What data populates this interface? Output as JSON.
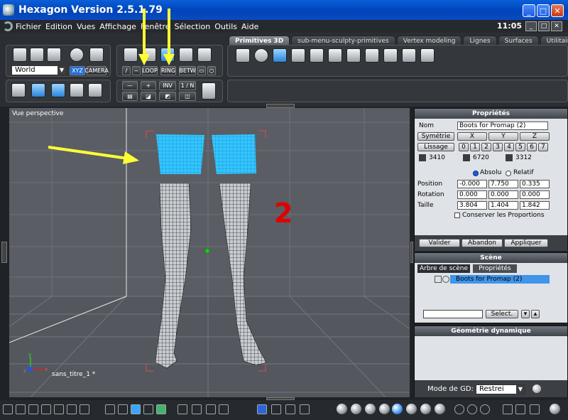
{
  "window": {
    "title": "Hexagon Version 2.5.1.79",
    "min": "_",
    "max": "□",
    "close": "✕"
  },
  "menu": {
    "items": [
      "Fichier",
      "Edition",
      "Vues",
      "Affichage",
      "Fenêtre",
      "Sélection",
      "Outils",
      "Aide"
    ],
    "time": "11:05",
    "doc_btns": [
      "_",
      "□",
      "✕"
    ]
  },
  "tabs": [
    "Primitives 3D",
    "sub-menu-sculpty-primitives",
    "Vertex modeling",
    "Lignes",
    "Surfaces",
    "Utilitaires"
  ],
  "toolbar": {
    "world_select": "World",
    "xyz_label": "XYZ",
    "camera_label": "CAMERA",
    "loop_label": "LOOP",
    "ring_label": "RING",
    "betw_label": "BETW",
    "minus_label": "—",
    "plus_label": "+",
    "inv_label": "INV",
    "one_n_label": "1 / N"
  },
  "viewport": {
    "label": "Vue perspective",
    "annotation_number": "2",
    "object_name": "sans_titre_1 *",
    "axis_labels": [
      "y",
      "z",
      "x"
    ]
  },
  "properties": {
    "title": "Propriétés",
    "name_label": "Nom",
    "name_value": "Boots for Promap (2)",
    "symmetry_btn": "Symétrie",
    "x": "X",
    "y": "Y",
    "z": "Z",
    "smooth_btn": "Lissage",
    "smooth_levels": [
      "0",
      "1",
      "2",
      "3",
      "4",
      "5",
      "6",
      "7"
    ],
    "counts": [
      "3410",
      "6720",
      "3312"
    ],
    "absolute": "Absolu",
    "relative": "Relatif",
    "position_label": "Position",
    "position": [
      "-0.000",
      "7.750",
      "0.335"
    ],
    "rotation_label": "Rotation",
    "rotation": [
      "0.000",
      "0.000",
      "0.000"
    ],
    "size_label": "Taille",
    "size": [
      "3.804",
      "1.404",
      "1.842"
    ],
    "keep_prop": "Conserver les Proportions",
    "validate_btn": "Valider",
    "cancel_btn": "Abandon",
    "apply_btn": "Appliquer"
  },
  "scene": {
    "title": "Scène",
    "tab_tree": "Arbre de scène",
    "tab_props": "Propriétés",
    "item": "Boots for Promap (2)",
    "select_btn": "Select."
  },
  "geometry": {
    "title": "Géométrie dynamique",
    "mode_label": "Mode de GD:",
    "mode_value": "Restrei"
  },
  "colors": {
    "highlight_arrow": "#ffff33",
    "selection": "#33c6ff",
    "annotation": "#e00000"
  }
}
